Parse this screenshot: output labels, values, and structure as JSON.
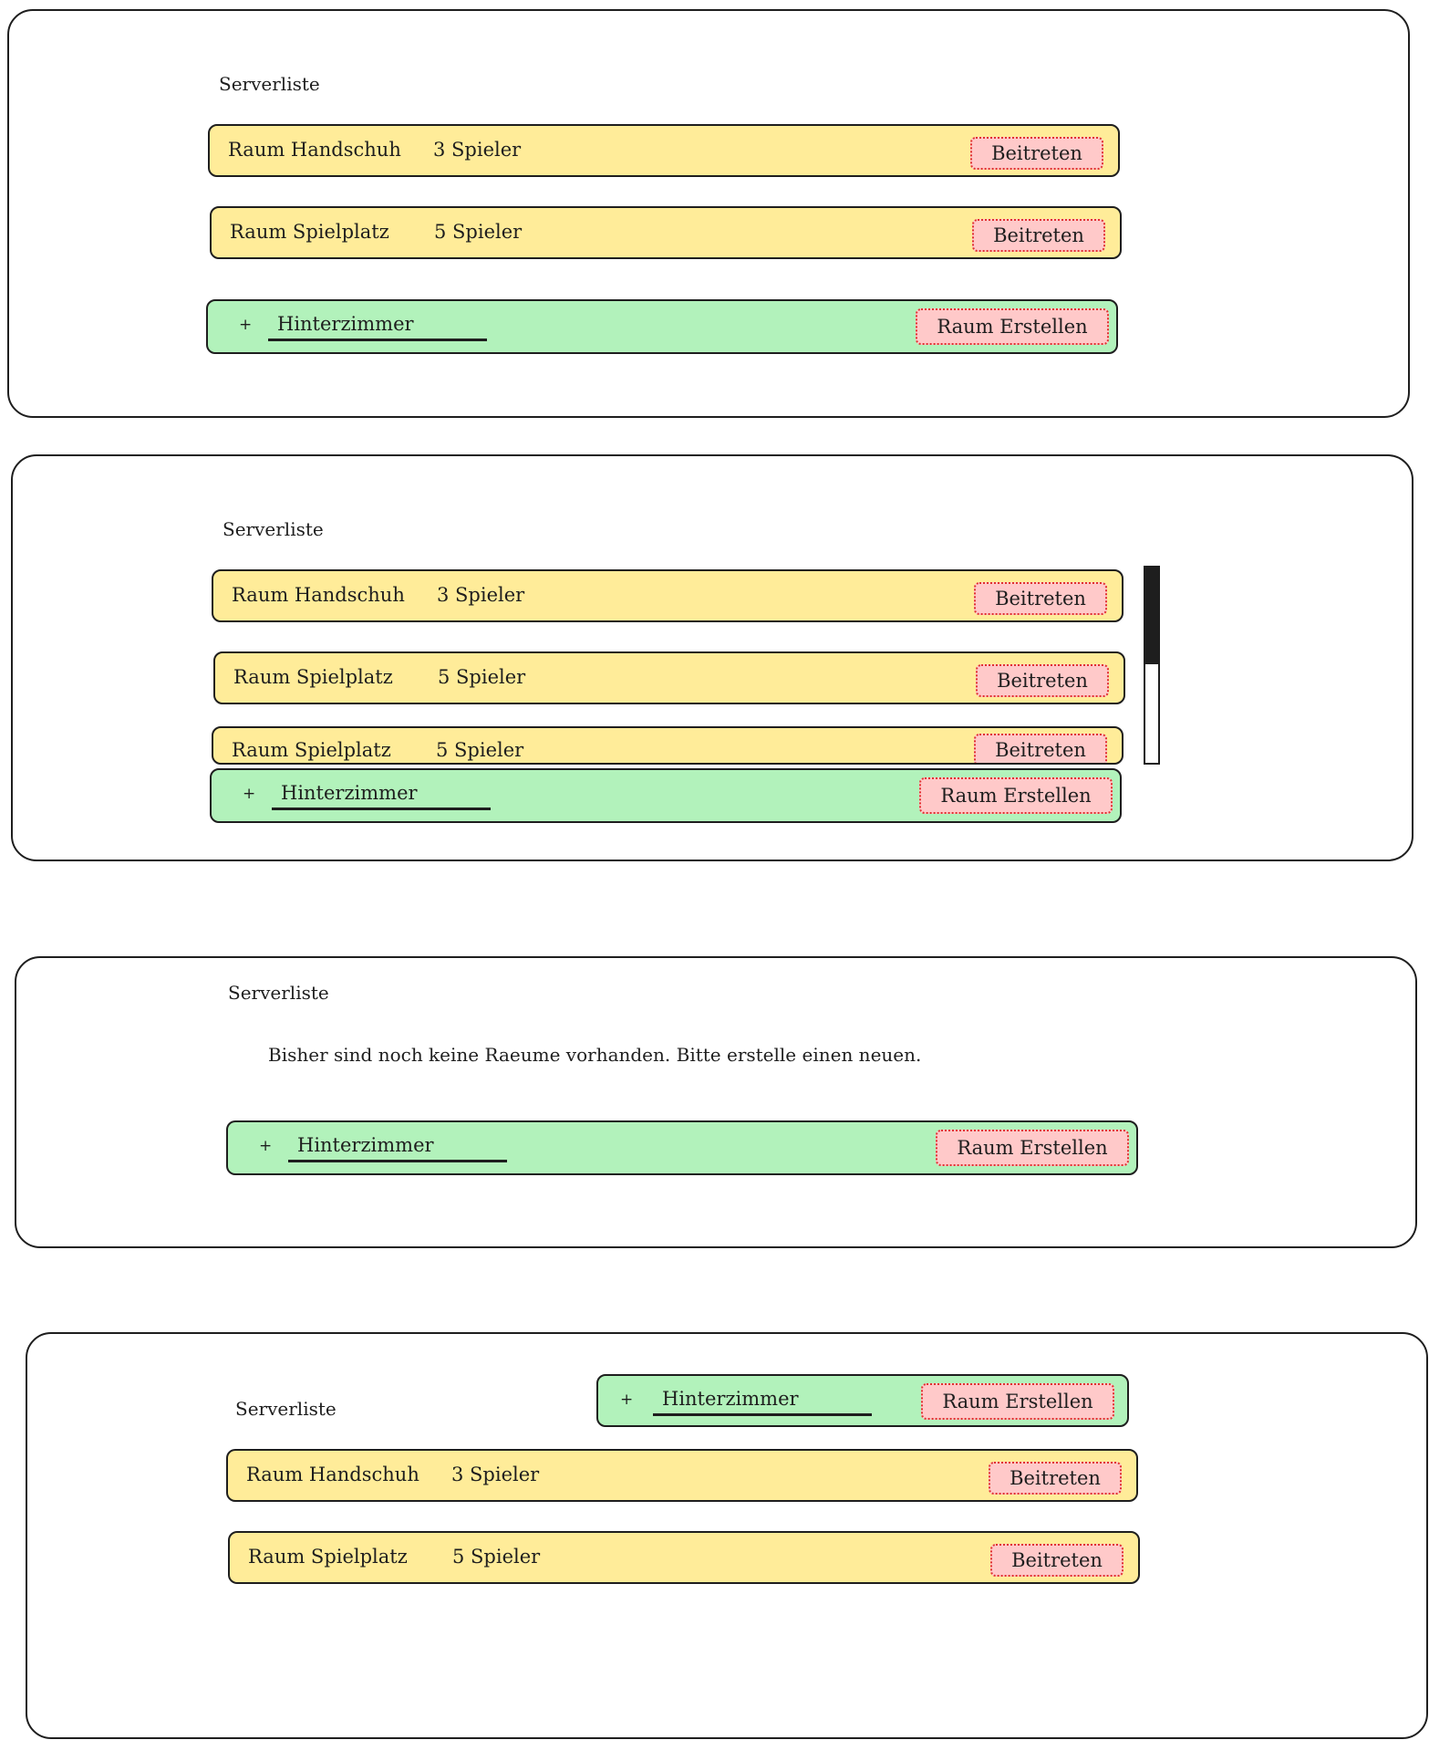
{
  "title": "Serverliste",
  "rooms": [
    {
      "name": "Raum Handschuh",
      "players": "3 Spieler"
    },
    {
      "name": "Raum Spielplatz",
      "players": "5 Spieler"
    }
  ],
  "join_label": "Beitreten",
  "create": {
    "value": "Hinterzimmer",
    "plus": "+",
    "button_label": "Raum Erstellen"
  },
  "empty_message": "Bisher sind noch keine Raeume vorhanden. Bitte erstelle einen neuen."
}
